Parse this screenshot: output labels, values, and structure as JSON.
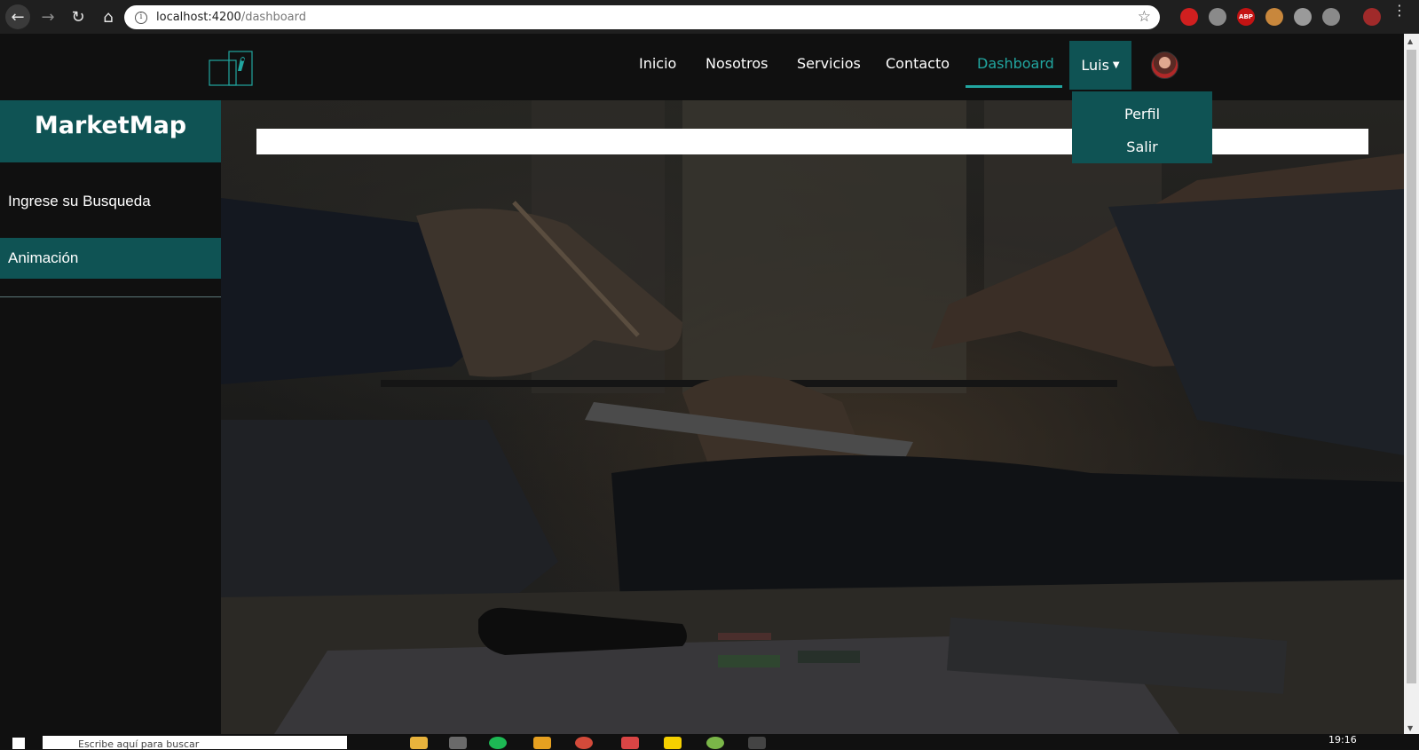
{
  "browser": {
    "url_host": "localhost:4200",
    "url_path": "/dashboard",
    "info_glyph": "i"
  },
  "navbar": {
    "links": [
      {
        "label": "Inicio"
      },
      {
        "label": "Nosotros"
      },
      {
        "label": "Servicios"
      },
      {
        "label": "Contacto"
      },
      {
        "label": "Dashboard",
        "active": true
      }
    ],
    "user_label": "Luis",
    "dropdown": {
      "items": [
        "Perfil",
        "Salir"
      ]
    }
  },
  "sidebar": {
    "brand": "MarketMap",
    "items": [
      {
        "label": "Ingrese su Busqueda"
      },
      {
        "label": "Animación",
        "active": true
      }
    ]
  },
  "main": {
    "search_value": ""
  },
  "extensions": [
    {
      "name": "red-hand-extension",
      "label": "",
      "color": "#d01f1f"
    },
    {
      "name": "camera-extension",
      "label": "",
      "color": "#8a8a8a"
    },
    {
      "name": "adblock-extension",
      "label": "ABP",
      "color": "#c41313"
    },
    {
      "name": "cookie-extension",
      "label": "",
      "color": "#c8873c"
    },
    {
      "name": "cube-extension",
      "label": "",
      "color": "#9a9a9a"
    },
    {
      "name": "bot-extension",
      "label": "",
      "color": "#8a8a8a"
    }
  ],
  "taskbar": {
    "search_text": "Escribe aquí para buscar",
    "clock": "19:16"
  },
  "colors": {
    "accent": "#21a6a0",
    "teal_dark": "#0f5354",
    "background": "#101010"
  }
}
